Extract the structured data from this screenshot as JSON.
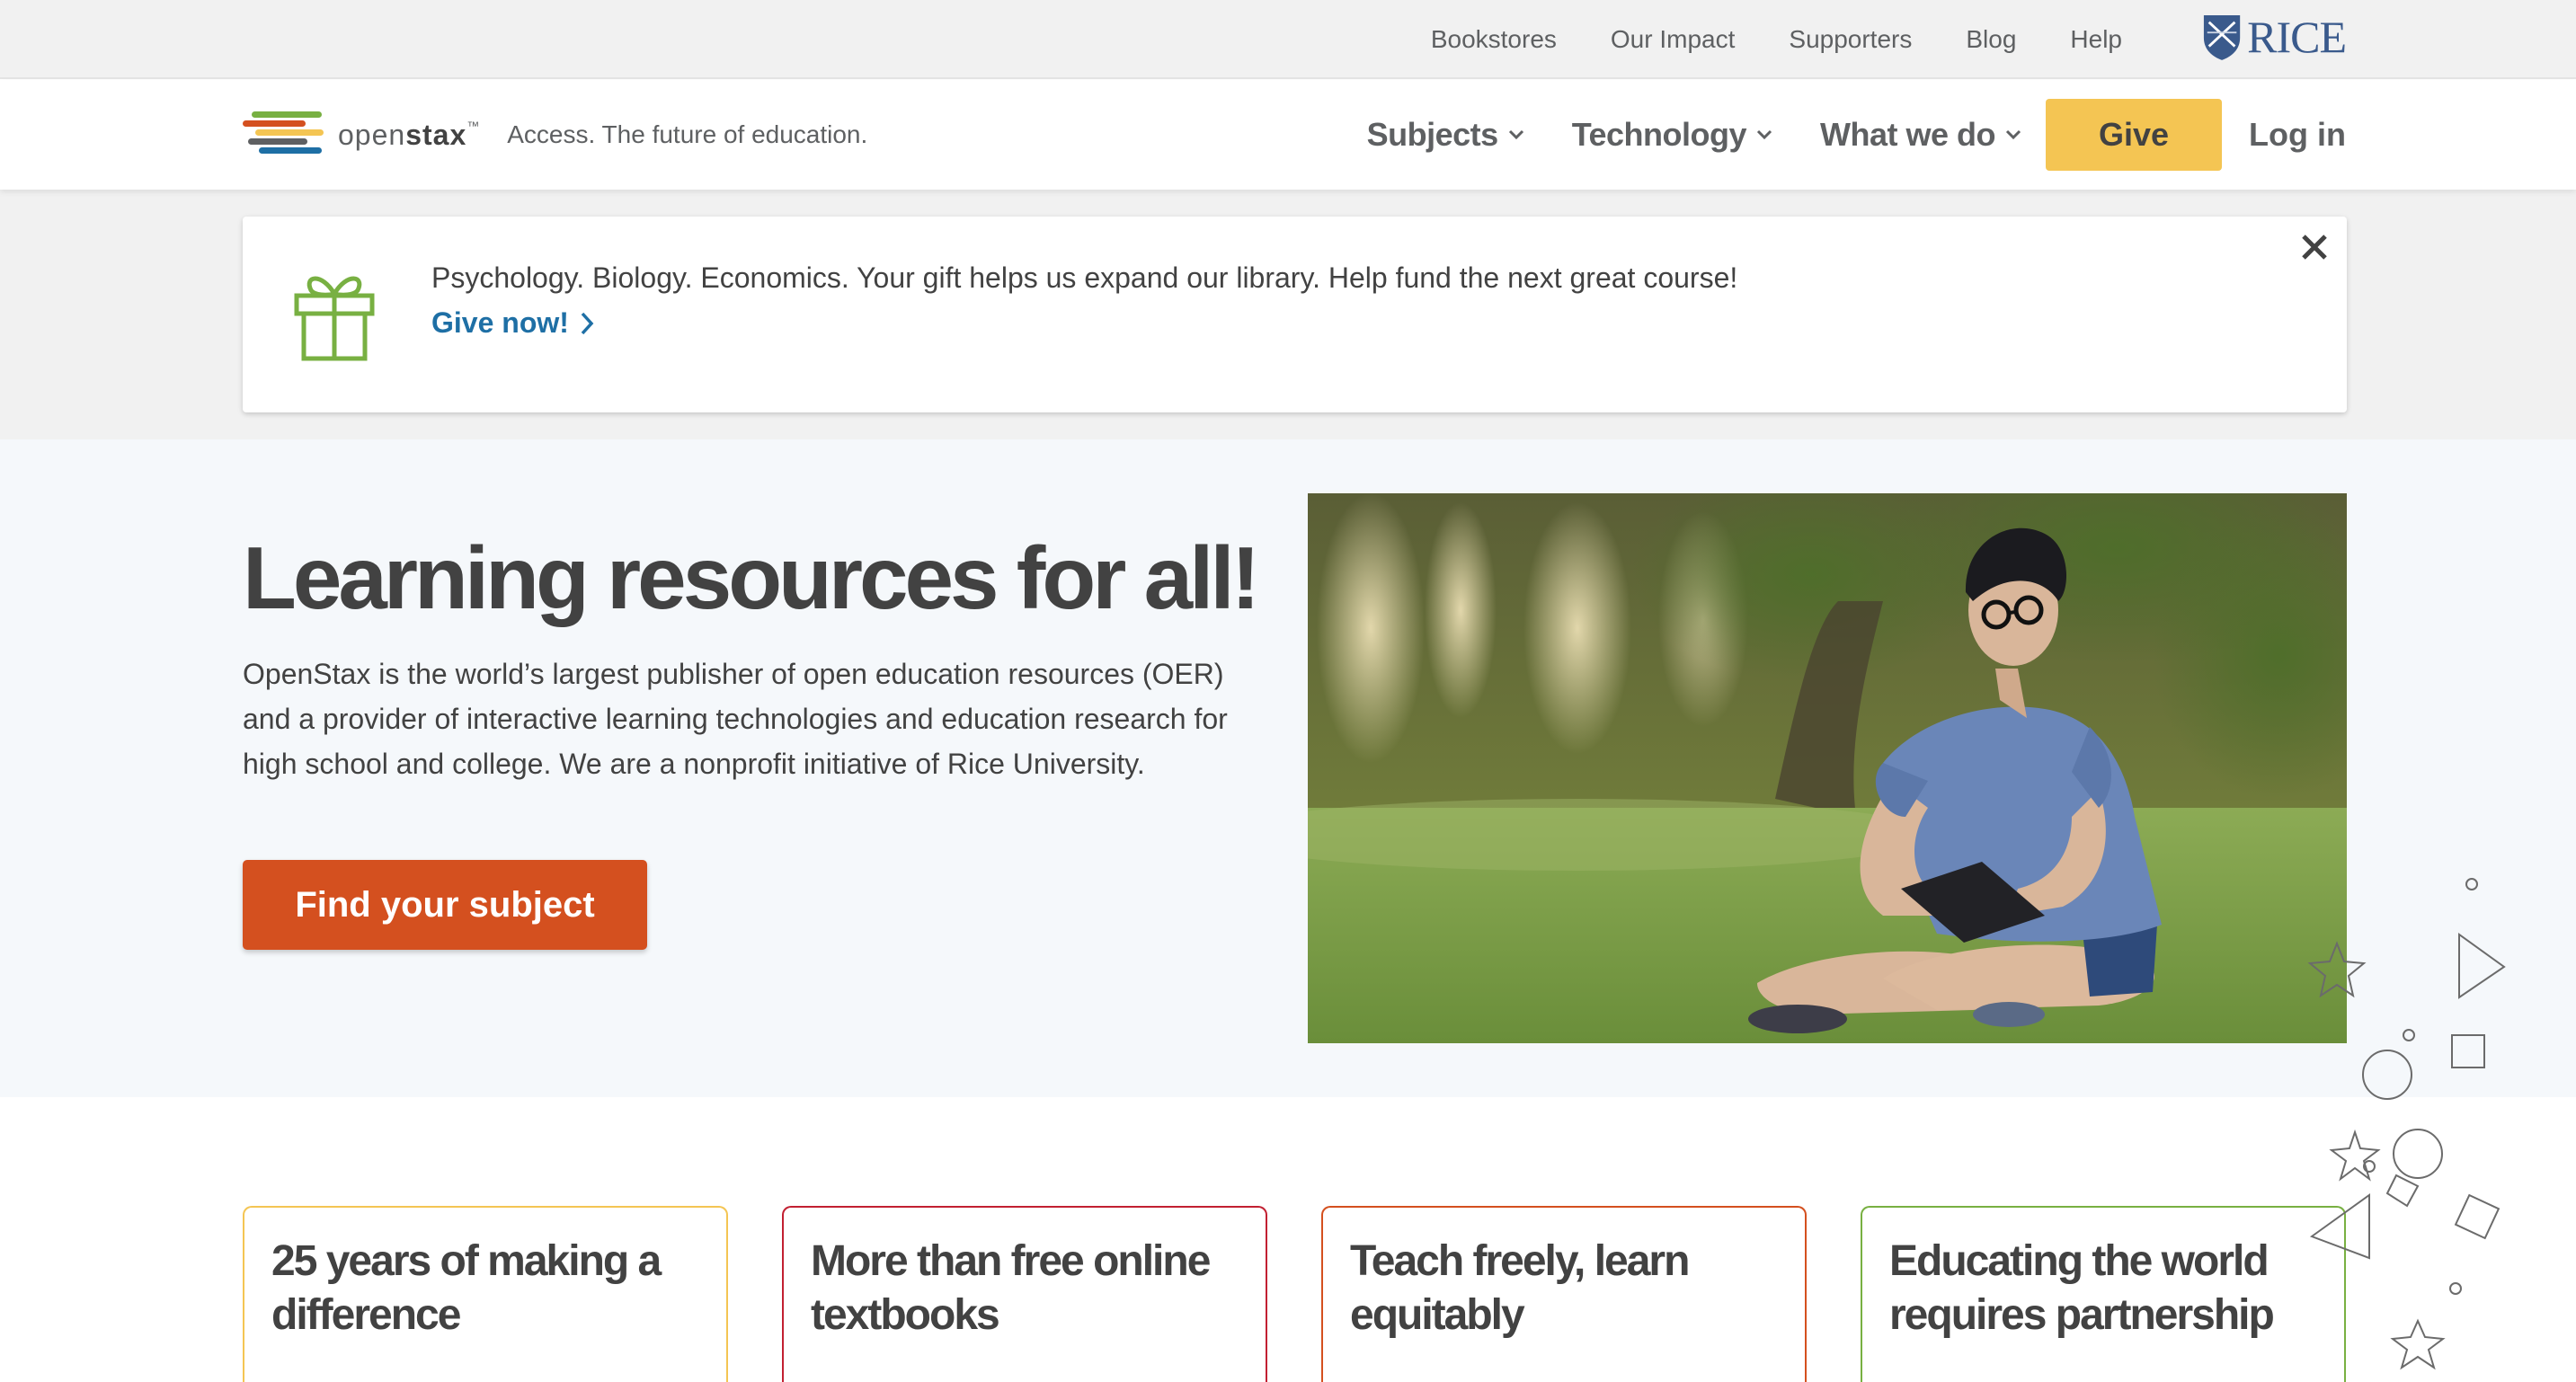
{
  "utility_nav": {
    "links": [
      "Bookstores",
      "Our Impact",
      "Supporters",
      "Blog",
      "Help"
    ],
    "rice_logo_text": "RICE"
  },
  "main_nav": {
    "brand_name_light": "open",
    "brand_name_bold": "stax",
    "brand_tm": "™",
    "tagline": "Access. The future of education.",
    "items": [
      "Subjects",
      "Technology",
      "What we do"
    ],
    "give_label": "Give",
    "login_label": "Log in"
  },
  "banner": {
    "message": "Psychology. Biology. Economics. Your gift helps us expand our library. Help fund the next great course!",
    "link_label": "Give now!",
    "icon": "gift-icon"
  },
  "hero": {
    "title": "Learning resources for all!",
    "description": "OpenStax is the world’s largest publisher of open education resources (OER) and a provider of interactive learning technologies and education research for high school and college. We are a nonprofit initiative of Rice University.",
    "cta_label": "Find your subject"
  },
  "cards": [
    {
      "title": "25 years of making a difference",
      "color": "#f4c553"
    },
    {
      "title": "More than free online textbooks",
      "color": "#c22032"
    },
    {
      "title": "Teach freely, learn equitably",
      "color": "#d4501f"
    },
    {
      "title": "Educating the world requires partnership",
      "color": "#78b042"
    }
  ],
  "colors": {
    "give_yellow": "#f4c553",
    "cta_orange": "#d4501f",
    "link_blue": "#1e6fa5",
    "gift_green": "#78b042"
  }
}
